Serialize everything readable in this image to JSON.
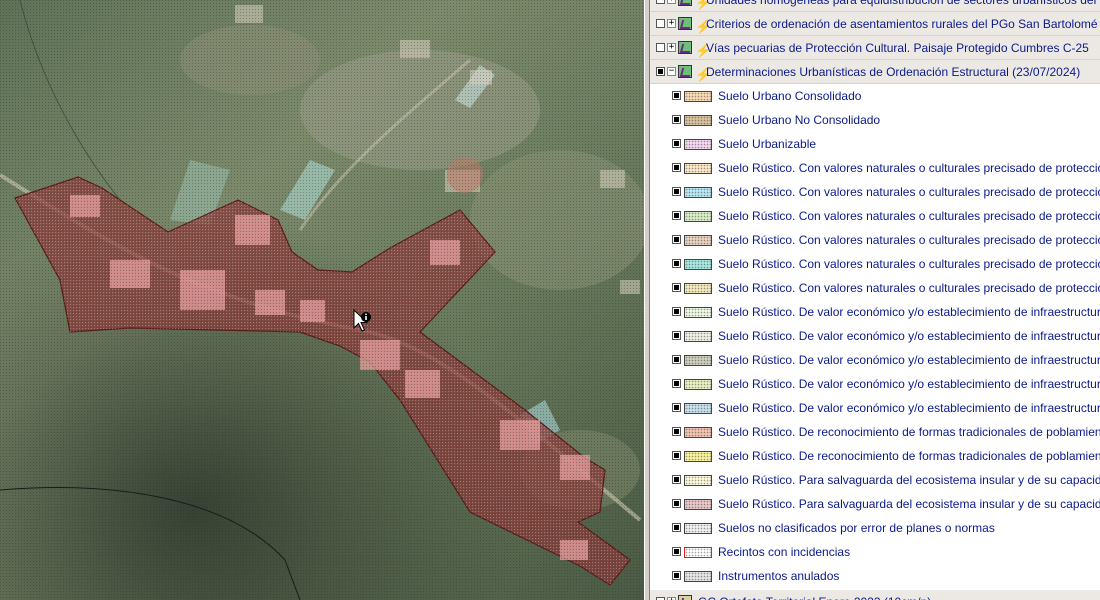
{
  "legend": {
    "groups": [
      {
        "label": "Unidades homogéneas para equidistribución de sectores urbanísticos del PGO El A",
        "expanded": false
      },
      {
        "label": "Criterios de ordenación de asentamientos rurales del PGo San Bartolomé",
        "expanded": false
      },
      {
        "label": "Vías pecuarias de Protección Cultural. Paisaje Protegido Cumbres C-25",
        "expanded": false
      },
      {
        "label": "Determinaciones Urbanísticas de Ordenación Estructural (23/07/2024)",
        "expanded": true
      }
    ],
    "items": [
      {
        "label": "Suelo Urbano Consolidado",
        "color": "#f7d9b4"
      },
      {
        "label": "Suelo Urbano No Consolidado",
        "color": "#d9c2a0"
      },
      {
        "label": "Suelo Urbanizable",
        "color": "#f3d6f0"
      },
      {
        "label": "Suelo Rústico. Con valores naturales o culturales precisado  de protección ambiental",
        "color": "#fbe7c9"
      },
      {
        "label": "Suelo Rústico. Con valores naturales o culturales precisado  de protección ambiental",
        "color": "#b8e6f2"
      },
      {
        "label": "Suelo Rústico. Con valores naturales o culturales precisado  de protección ambiental",
        "color": "#d8ecc8"
      },
      {
        "label": "Suelo Rústico. Con valores naturales o culturales precisado  de protección ambiental",
        "color": "#e8d2c0"
      },
      {
        "label": "Suelo Rústico. Con valores naturales o culturales precisado  de protección ambiental",
        "color": "#a8e6e0"
      },
      {
        "label": "Suelo Rústico. Con valores naturales o culturales precisado  de protección ambiental",
        "color": "#f4e8c0"
      },
      {
        "label": "Suelo Rústico. De  valor económico y/o  establecimiento de infraestructuras",
        "color": "#eef6e4"
      },
      {
        "label": "Suelo Rústico. De  valor económico y/o  establecimiento de infraestructuras",
        "color": "#f0efe6"
      },
      {
        "label": "Suelo Rústico. De  valor económico y/o  establecimiento de infraestructuras",
        "color": "#cfcfc0"
      },
      {
        "label": "Suelo Rústico. De  valor económico y/o  establecimiento de infraestructuras",
        "color": "#e6efc4"
      },
      {
        "label": "Suelo Rústico. De  valor económico y/o  establecimiento de infraestructuras",
        "color": "#c8e2ec"
      },
      {
        "label": "Suelo Rústico. De reconocimiento de formas tradicionales de poblamiento rural",
        "color": "#f2c2b2"
      },
      {
        "label": "Suelo Rústico. De reconocimiento de formas tradicionales de poblamiento rural",
        "color": "#f7f1a0"
      },
      {
        "label": "Suelo Rústico. Para salvaguarda del ecosistema insular y de  su capacidad de sustentación",
        "color": "#fbf7dc"
      },
      {
        "label": "Suelo Rústico. Para salvaguarda del ecosistema insular y de  su capacidad de sustentación",
        "color": "#e8c8c8"
      },
      {
        "label": "Suelos no clasificados por error de planes o normas",
        "color": "#f0f0f0"
      },
      {
        "label": "Recintos con incidencias",
        "color": "#ffffff",
        "border": "#e02020"
      },
      {
        "label": "Instrumentos anulados",
        "color": "#e4e4e4"
      }
    ],
    "footer_group": {
      "label": "GC Ortofoto Territorial Enero 2023 (10cm/p)"
    }
  },
  "colors": {
    "polygon_fill": "#8a3a3a",
    "polygon_stroke": "#5a1a1a",
    "map_hatch": "#4d6a56",
    "legend_text": "#0a1a8c"
  },
  "map": {
    "cursor_icon": "info-pointer-icon"
  }
}
